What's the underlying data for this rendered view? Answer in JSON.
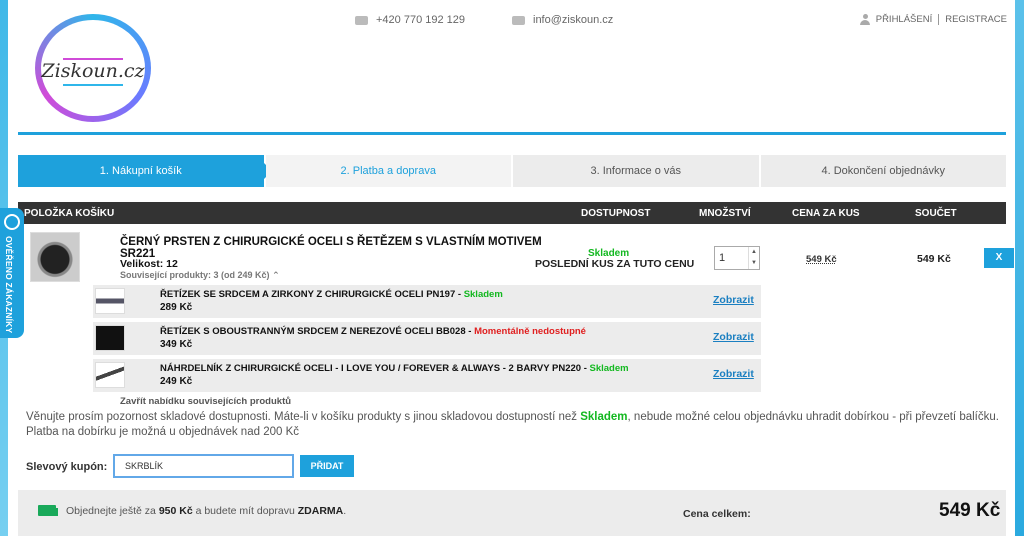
{
  "header": {
    "logo_text": "Ziskoun.cz",
    "phone": "+420 770 192 129",
    "email": "info@ziskoun.cz",
    "login": "PŘIHLÁŠENÍ",
    "register": "REGISTRACE"
  },
  "steps": [
    {
      "label": "1. Nákupní košík"
    },
    {
      "label": "2. Platba a doprava"
    },
    {
      "label": "3. Informace o vás"
    },
    {
      "label": "4. Dokončení objednávky"
    }
  ],
  "table_headers": {
    "item": "POLOŽKA KOŠÍKU",
    "availability": "DOSTUPNOST",
    "quantity": "MNOŽSTVÍ",
    "unit_price": "CENA ZA KUS",
    "total": "SOUČET"
  },
  "product": {
    "name": "ČERNÝ PRSTEN Z CHIRURGICKÉ OCELI S ŘETĚZEM S VLASTNÍM MOTIVEM",
    "code": "SR221",
    "size": "Velikost: 12",
    "related_toggle": "Související produkty: 3 (od 249 Kč)",
    "availability": "Skladem",
    "availability_note": "POSLEDNÍ KUS ZA TUTO CENU",
    "quantity": "1",
    "unit_price": "549 Kč",
    "subtotal": "549 Kč",
    "remove_label": "X"
  },
  "related": [
    {
      "name": "ŘETÍZEK SE SRDCEM A ZIRKONY Z CHIRURGICKÉ OCELI PN197 - ",
      "status": "Skladem",
      "in_stock": true,
      "price": "289 Kč",
      "link": "Zobrazit"
    },
    {
      "name": "ŘETÍZEK S OBOUSTRANNÝM SRDCEM Z NEREZOVÉ OCELI BB028 - ",
      "status": "Momentálně nedostupné",
      "in_stock": false,
      "price": "349 Kč",
      "link": "Zobrazit"
    },
    {
      "name": "NÁHRDELNÍK Z CHIRURGICKÉ OCELI - I LOVE YOU / FOREVER & ALWAYS - 2 BARVY PN220 - ",
      "status": "Skladem",
      "in_stock": true,
      "price": "249 Kč",
      "link": "Zobrazit"
    }
  ],
  "close_related": "Zavřít nabídku souvisejících produktů",
  "note": {
    "part1": "Věnujte prosím pozornost skladové dostupnosti. Máte-li v košíku produkty s jinou skladovou dostupností než ",
    "highlight": "Skladem",
    "part2": ", nebude možné celou objednávku uhradit dobírkou - při převzetí balíčku. Platba na dobírku je možná u objednávek nad 200 Kč"
  },
  "coupon": {
    "label": "Slevový kupón:",
    "value": "SKRBLÍK",
    "button": "PŘIDAT"
  },
  "footer": {
    "shipping_prefix": "Objednejte ještě za ",
    "shipping_amount": "950 Kč",
    "shipping_middle": " a budete mít dopravu ",
    "shipping_free": "ZDARMA",
    "shipping_suffix": ".",
    "total_label": "Cena celkem:",
    "total_value": "549 Kč"
  },
  "badge": {
    "text": "OVĚŘENO ZÁKAZNÍKY"
  },
  "colors": {
    "accent": "#1ea1dc",
    "in_stock": "#13b820",
    "out_of_stock": "#e02020"
  }
}
